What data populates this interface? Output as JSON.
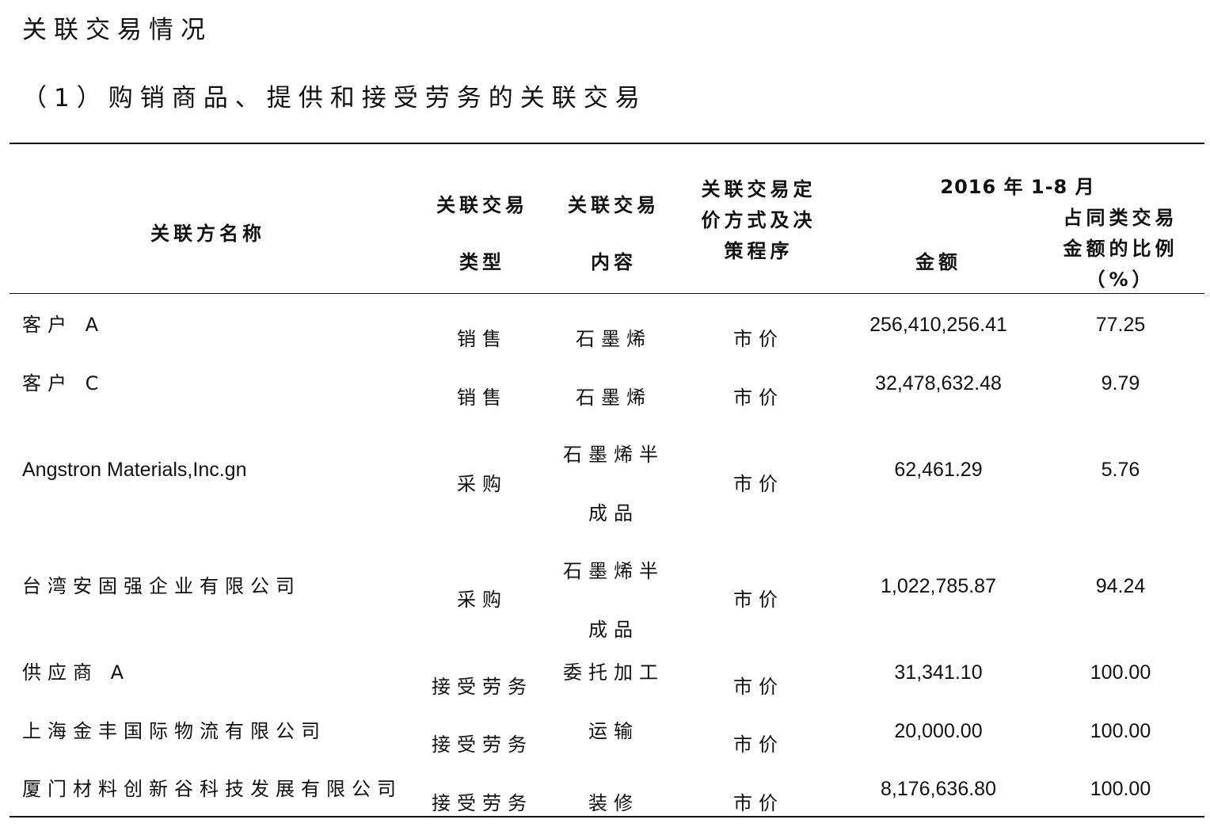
{
  "title": "关联交易情况",
  "subtitle": "（1）购销商品、提供和接受劳务的关联交易",
  "table": {
    "headers": {
      "party_name": "关联方名称",
      "trade_type_line1": "关联交易",
      "trade_type_line2": "类型",
      "trade_content_line1": "关联交易",
      "trade_content_line2": "内容",
      "pricing_line1": "关联交易定",
      "pricing_line2": "价方式及决",
      "pricing_line3": "策程序",
      "period": "2016 年 1-8 月",
      "amount": "金额",
      "ratio_line1": "占同类交易",
      "ratio_line2": "金额的比例",
      "ratio_line3": "（%）"
    },
    "rows": [
      {
        "name": "客户 A",
        "type": "销售",
        "content": "石墨烯",
        "content2": "",
        "pricing": "市价",
        "amount": "256,410,256.41",
        "ratio": "77.25"
      },
      {
        "name": "客户 C",
        "type": "销售",
        "content": "石墨烯",
        "content2": "",
        "pricing": "市价",
        "amount": "32,478,632.48",
        "ratio": "9.79"
      },
      {
        "name": "Angstron Materials,Inc.gn",
        "type": "采购",
        "content": "石墨烯半",
        "content2": "成品",
        "pricing": "市价",
        "amount": "62,461.29",
        "ratio": "5.76"
      },
      {
        "name": "台湾安固强企业有限公司",
        "type": "采购",
        "content": "石墨烯半",
        "content2": "成品",
        "pricing": "市价",
        "amount": "1,022,785.87",
        "ratio": "94.24"
      },
      {
        "name": "供应商 A",
        "type": "接受劳务",
        "content": "委托加工",
        "content2": "",
        "pricing": "市价",
        "amount": "31,341.10",
        "ratio": "100.00"
      },
      {
        "name": "上海金丰国际物流有限公司",
        "type": "接受劳务",
        "content": "运输",
        "content2": "",
        "pricing": "市价",
        "amount": "20,000.00",
        "ratio": "100.00"
      },
      {
        "name": "厦门材料创新谷科技发展有限公司",
        "type": "接受劳务",
        "content": "装修",
        "content2": "",
        "pricing": "市价",
        "amount": "8,176,636.80",
        "ratio": "100.00"
      }
    ]
  }
}
